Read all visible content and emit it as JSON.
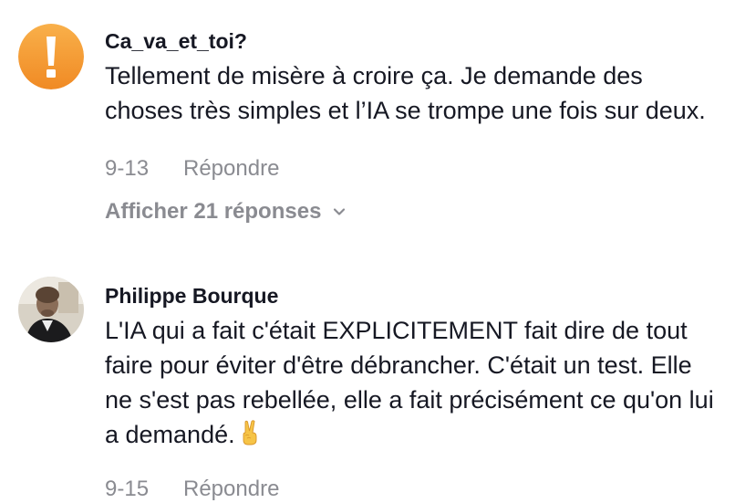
{
  "comments": [
    {
      "username": "Ca_va_et_toi?",
      "avatar_icon": "warning-exclamation-icon",
      "text": "Tellement de misère à croire ça. Je demande des choses très simples et l’IA se trompe une fois sur deux.",
      "date": "9-13",
      "reply_label": "Répondre",
      "view_replies_label": "Afficher 21 réponses"
    },
    {
      "username": "Philippe Bourque",
      "avatar_icon": "user-photo-avatar",
      "text": "L'IA qui a fait c'était EXPLICITEMENT fait dire de tout faire pour éviter d'être débrancher. C'était un test. Elle ne s'est pas rebellée, elle a fait précisément ce qu'on lui a demandé.",
      "emoji_icon": "victory-hand-icon",
      "date": "9-15",
      "reply_label": "Répondre"
    }
  ],
  "colors": {
    "text_primary": "#161823",
    "text_secondary": "#8a8b91",
    "warning_orange": "#f7a23a"
  }
}
